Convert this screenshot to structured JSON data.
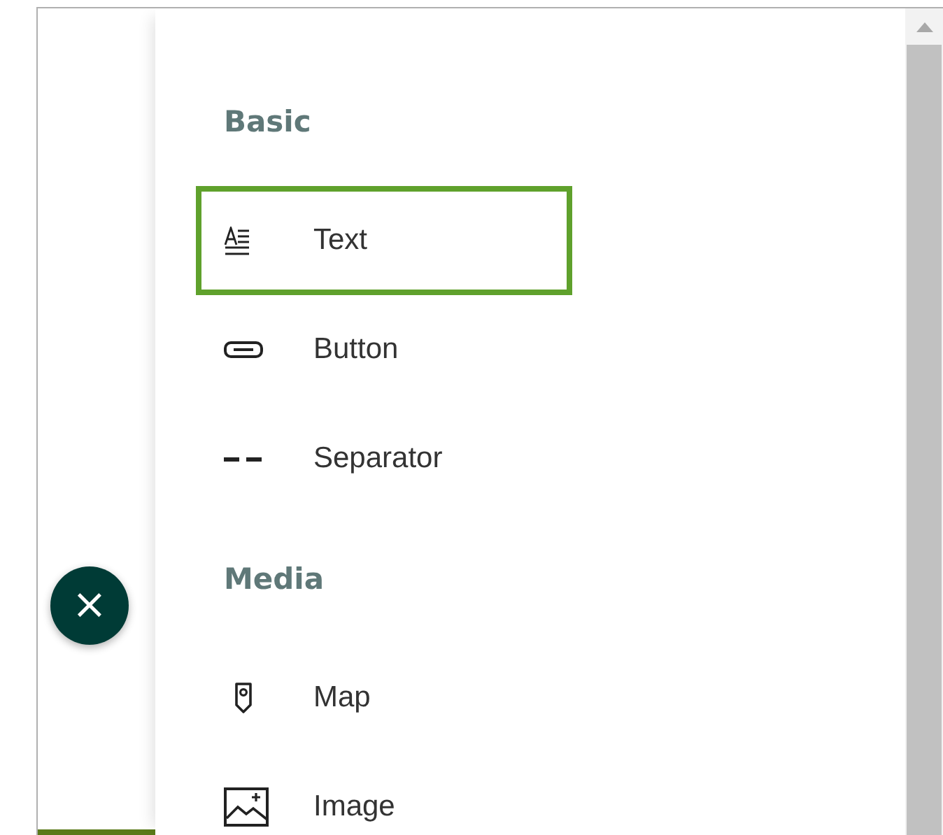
{
  "sections": [
    {
      "title": "Basic",
      "items": [
        {
          "kind": "text",
          "label": "Text",
          "selected": true
        },
        {
          "kind": "button",
          "label": "Button",
          "selected": false
        },
        {
          "kind": "separator",
          "label": "Separator",
          "selected": false
        }
      ]
    },
    {
      "title": "Media",
      "items": [
        {
          "kind": "map",
          "label": "Map",
          "selected": false
        },
        {
          "kind": "image",
          "label": "Image",
          "selected": false
        }
      ]
    }
  ],
  "close_button": {
    "label": "×"
  }
}
